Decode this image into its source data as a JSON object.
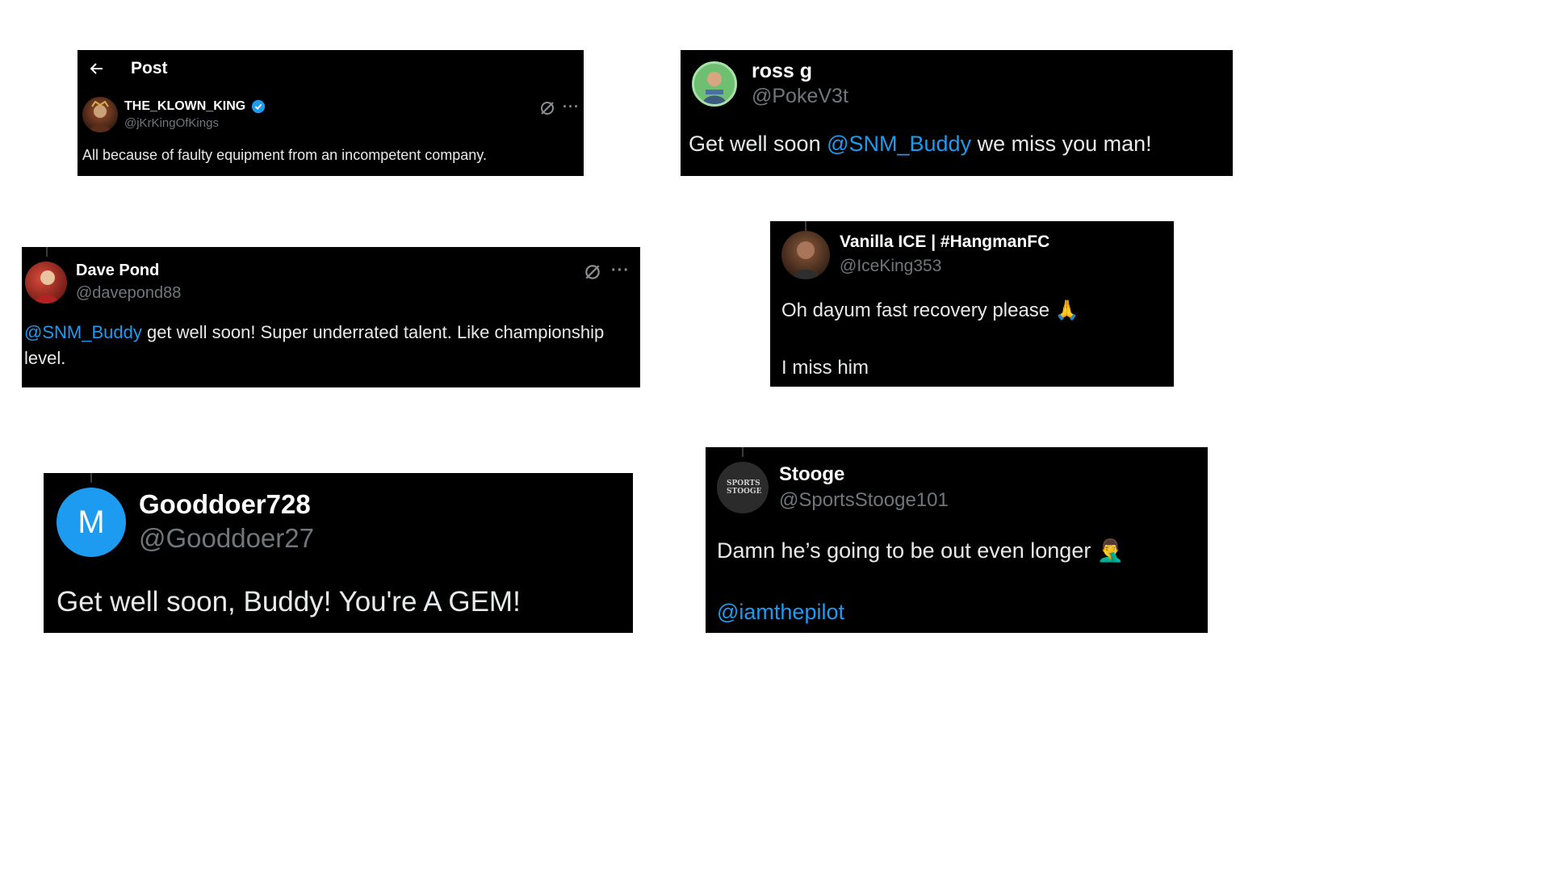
{
  "colors": {
    "card_bg": "#000000",
    "mention": "#1d9bf0",
    "handle": "#71767b",
    "verified": "#1d9bf0",
    "gooddoer_avatar": "#1d9bf0"
  },
  "tweets": [
    {
      "header_title": "Post",
      "name": "THE_KLOWN_KING",
      "handle": "@jKrKingOfKings",
      "verified": true,
      "text": "All because of faulty equipment from an incompetent company."
    },
    {
      "name": "ross g",
      "handle": "@PokeV3t",
      "text_before": "Get well soon ",
      "mention": "@SNM_Buddy",
      "text_after": " we miss you man!"
    },
    {
      "name": "Dave Pond",
      "handle": "@davepond88",
      "mention": "@SNM_Buddy",
      "text_after": " get well soon! Super underrated talent. Like championship level."
    },
    {
      "name": "Vanilla ICE | #HangmanFC",
      "handle": "@IceKing353",
      "line1": "Oh dayum fast recovery please 🙏",
      "line2": "I miss him"
    },
    {
      "name": "Gooddoer728",
      "handle": "@Gooddoer27",
      "avatar_letter": "M",
      "text": "Get well soon, Buddy! You're A GEM!"
    },
    {
      "name": "Stooge",
      "handle": "@SportsStooge101",
      "avatar_text": "SPORTS STOOGE",
      "line1": "Damn he’s going to be out even longer 🤦‍♂️",
      "mention": "@iamthepilot"
    }
  ]
}
